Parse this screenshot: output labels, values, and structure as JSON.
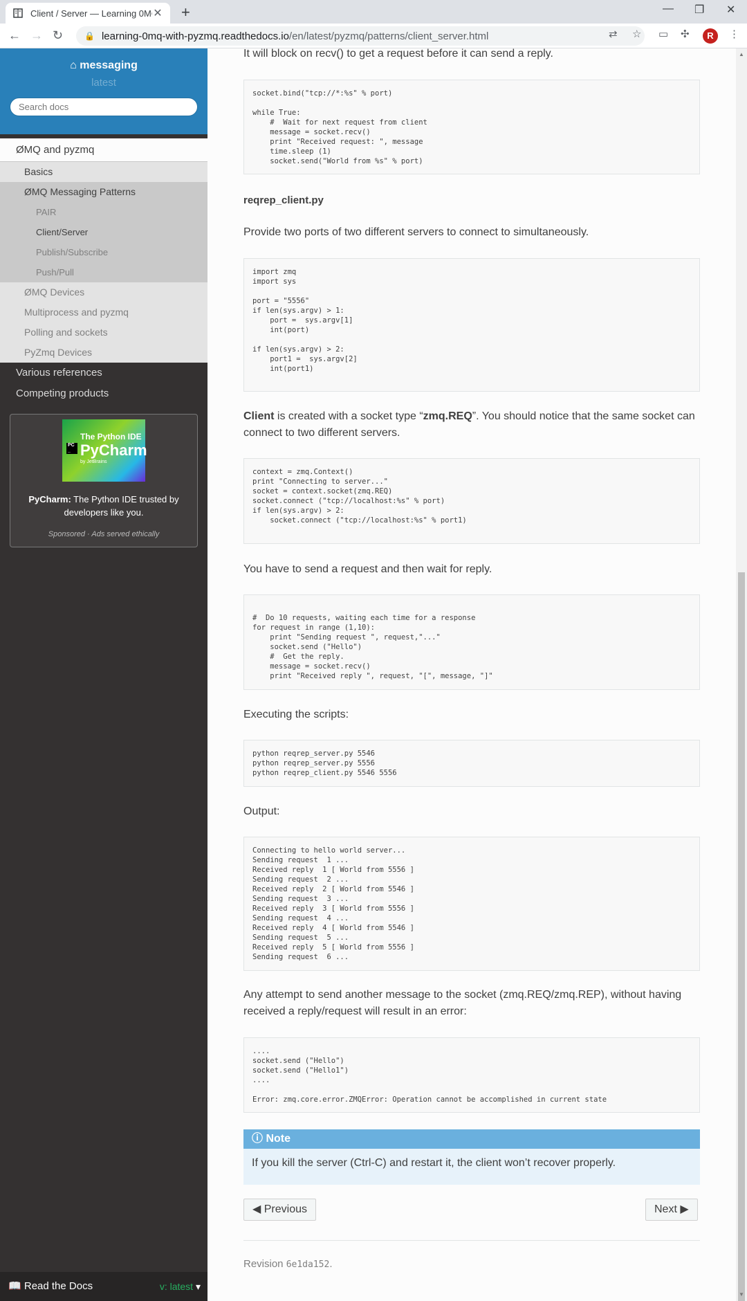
{
  "browser": {
    "tab_title": "Client / Server — Learning 0MQ",
    "url_domain": "learning-0mq-with-pyzmq.readthedocs.io",
    "url_path": "/en/latest/pyzmq/patterns/client_server.html",
    "avatar_letter": "R"
  },
  "sidebar": {
    "project": "messaging",
    "version": "latest",
    "search_placeholder": "Search docs",
    "items": {
      "zmq_pyzmq": "ØMQ and pyzmq",
      "basics": "Basics",
      "patterns": "ØMQ Messaging Patterns",
      "pair": "PAIR",
      "client_server": "Client/Server",
      "pubsub": "Publish/Subscribe",
      "pushpull": "Push/Pull",
      "devices": "ØMQ Devices",
      "multiprocess": "Multiprocess and pyzmq",
      "polling": "Polling and sockets",
      "pyzmq_devices": "PyZmq Devices",
      "references": "Various references",
      "competing": "Competing products"
    },
    "ad": {
      "img_line1": "The Python IDE",
      "img_line2": "PyCharm",
      "img_line3": "by JetBrains",
      "brand": "PyCharm:",
      "text": " The Python IDE trusted by developers like you.",
      "footer": "Sponsored · Ads served ethically"
    },
    "rtd_label": "Read the Docs",
    "rtd_version": "v: latest"
  },
  "content": {
    "p_block": "It will block on recv() to get a request before it can send a reply.",
    "code_server": "socket.bind(\"tcp://*:%s\" % port)\n\nwhile True:\n    #  Wait for next request from client\n    message = socket.recv()\n    print \"Received request: \", message\n    time.sleep (1)\n    socket.send(\"World from %s\" % port)",
    "h_client": "reqrep_client.py",
    "p_ports": "Provide two ports of two different servers to connect to simultaneously.",
    "code_client_args": "import zmq\nimport sys\n\nport = \"5556\"\nif len(sys.argv) > 1:\n    port =  sys.argv[1]\n    int(port)\n\nif len(sys.argv) > 2:\n    port1 =  sys.argv[2]\n    int(port1)",
    "p_client_bold": "Client",
    "p_client_mid": " is created with a socket type “",
    "p_client_code": "zmq.REQ",
    "p_client_end": "”. You should notice that the same socket can connect to two different servers.",
    "code_connect": "context = zmq.Context()\nprint \"Connecting to server...\"\nsocket = context.socket(zmq.REQ)\nsocket.connect (\"tcp://localhost:%s\" % port)\nif len(sys.argv) > 2:\n    socket.connect (\"tcp://localhost:%s\" % port1)",
    "p_send": "You have to send a request and then wait for reply.",
    "code_requests": "\n#  Do 10 requests, waiting each time for a response\nfor request in range (1,10):\n    print \"Sending request \", request,\"...\"\n    socket.send (\"Hello\")\n    #  Get the reply.\n    message = socket.recv()\n    print \"Received reply \", request, \"[\", message, \"]\"",
    "p_exec": "Executing the scripts:",
    "code_exec": "python reqrep_server.py 5546\npython reqrep_server.py 5556\npython reqrep_client.py 5546 5556",
    "p_output": "Output:",
    "code_output": "Connecting to hello world server...\nSending request  1 ...\nReceived reply  1 [ World from 5556 ]\nSending request  2 ...\nReceived reply  2 [ World from 5546 ]\nSending request  3 ...\nReceived reply  3 [ World from 5556 ]\nSending request  4 ...\nReceived reply  4 [ World from 5546 ]\nSending request  5 ...\nReceived reply  5 [ World from 5556 ]\nSending request  6 ...",
    "p_attempt": "Any attempt to send another message to the socket (zmq.REQ/zmq.REP), without having received a reply/request will result in an error:",
    "code_error": "....\nsocket.send (\"Hello\")\nsocket.send (\"Hello1\")\n....\n\nError: zmq.core.error.ZMQError: Operation cannot be accomplished in current state",
    "note_title": "Note",
    "note_text": "If you kill the server (Ctrl-C) and restart it, the client won’t recover properly.",
    "prev_label": "Previous",
    "next_label": "Next",
    "revision_label": "Revision ",
    "revision_hash": "6e1da152",
    "revision_end": "."
  }
}
